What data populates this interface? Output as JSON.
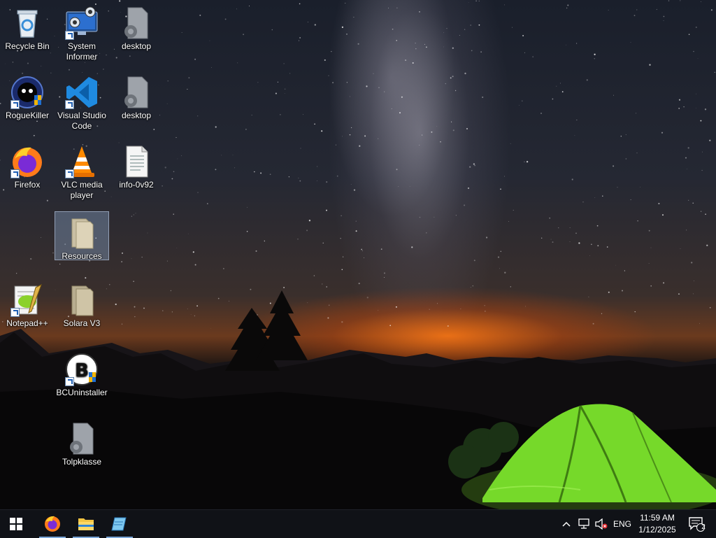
{
  "desktop": {
    "icons": [
      {
        "label": "Recycle Bin",
        "icon": "recycle-bin-icon"
      },
      {
        "label": "System\nInformer",
        "icon": "system-informer-icon"
      },
      {
        "label": "desktop",
        "icon": "settings-file-icon"
      },
      {
        "label": "RogueKiller",
        "icon": "roguekiller-icon"
      },
      {
        "label": "Visual Studio\nCode",
        "icon": "vscode-icon"
      },
      {
        "label": "desktop",
        "icon": "settings-file-icon"
      },
      {
        "label": "Firefox",
        "icon": "firefox-icon"
      },
      {
        "label": "VLC media\nplayer",
        "icon": "vlc-icon"
      },
      {
        "label": "info-0v92",
        "icon": "text-file-icon"
      },
      {
        "label": "Resources",
        "icon": "folder-icon"
      },
      {
        "label": "Notepad++",
        "icon": "notepadpp-icon"
      },
      {
        "label": "Solara V3",
        "icon": "folder-icon"
      },
      {
        "label": "BCUninstaller",
        "icon": "bcuninstaller-icon"
      },
      {
        "label": "Tolpklasse",
        "icon": "settings-file-icon"
      }
    ],
    "selected_icon": "Resources"
  },
  "taskbar": {
    "start_icon": "windows-start-icon",
    "pinned": [
      {
        "name": "Firefox",
        "icon": "firefox-icon"
      },
      {
        "name": "File Explorer",
        "icon": "file-explorer-icon"
      },
      {
        "name": "Notepad",
        "icon": "notepad-icon"
      }
    ],
    "tray": {
      "language": "ENG",
      "time": "11:59 AM",
      "date": "1/12/2025",
      "notification_count": "2"
    }
  },
  "colors": {
    "taskbar_bg": "#101217",
    "accent": "#7aa6d8",
    "tent": "#7be32a"
  }
}
